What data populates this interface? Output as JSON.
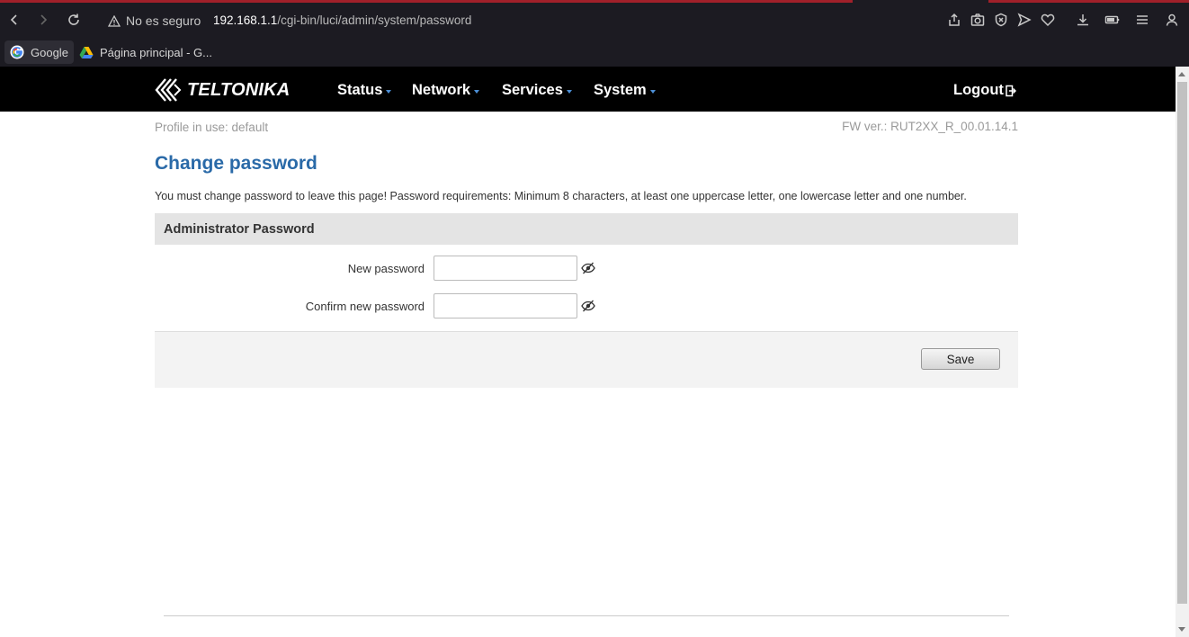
{
  "browser": {
    "security_warning": "No es seguro",
    "url_host": "192.168.1.1",
    "url_path": "/cgi-bin/luci/admin/system/password",
    "bookmarks": [
      {
        "label": "Google",
        "icon": "google-icon"
      },
      {
        "label": "Página principal - G...",
        "icon": "drive-icon"
      }
    ]
  },
  "header": {
    "logo": "TELTONIKA",
    "menu": [
      {
        "label": "Status"
      },
      {
        "label": "Network"
      },
      {
        "label": "Services"
      },
      {
        "label": "System"
      }
    ],
    "logout": "Logout"
  },
  "page": {
    "profile": "Profile in use: default",
    "firmware": "FW ver.: RUT2XX_R_00.01.14.1",
    "title": "Change password",
    "description": "You must change password to leave this page! Password requirements: Minimum 8 characters, at least one uppercase letter, one lowercase letter and one number.",
    "section_title": "Administrator Password",
    "fields": [
      {
        "label": "New password",
        "value": ""
      },
      {
        "label": "Confirm new password",
        "value": ""
      }
    ],
    "save_label": "Save"
  },
  "colors": {
    "header_bg": "#000000",
    "title": "#2a6aa8",
    "menu_caret": "#4c8fd6",
    "section_bg": "#e4e4e4"
  }
}
